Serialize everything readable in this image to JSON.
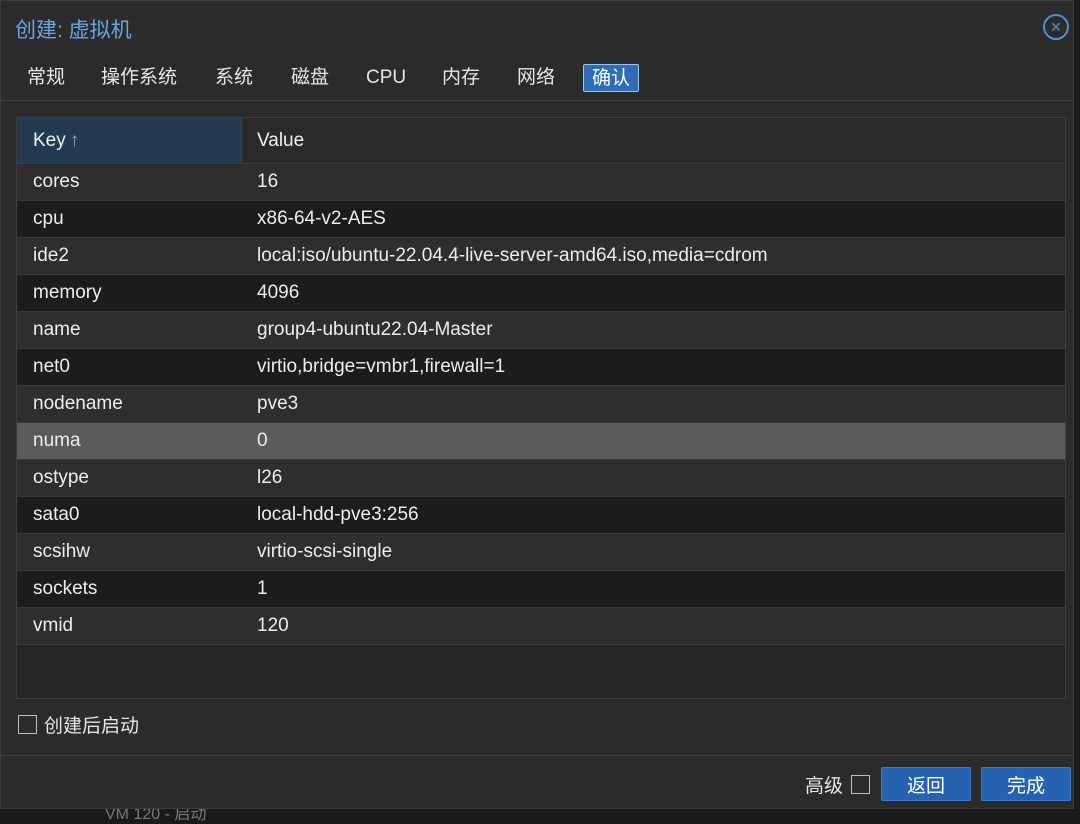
{
  "window": {
    "title": "创建: 虚拟机",
    "close_glyph": "✕"
  },
  "background": {
    "partial_text": "VM 120 - 启动"
  },
  "tabs": [
    {
      "label": "常规",
      "active": false
    },
    {
      "label": "操作系统",
      "active": false
    },
    {
      "label": "系统",
      "active": false
    },
    {
      "label": "磁盘",
      "active": false
    },
    {
      "label": "CPU",
      "active": false
    },
    {
      "label": "内存",
      "active": false
    },
    {
      "label": "网络",
      "active": false
    },
    {
      "label": "确认",
      "active": true
    }
  ],
  "grid": {
    "columns": {
      "key": "Key",
      "key_sort_glyph": "↑",
      "value": "Value"
    },
    "rows": [
      {
        "key": "cores",
        "value": "16"
      },
      {
        "key": "cpu",
        "value": "x86-64-v2-AES"
      },
      {
        "key": "ide2",
        "value": "local:iso/ubuntu-22.04.4-live-server-amd64.iso,media=cdrom"
      },
      {
        "key": "memory",
        "value": "4096"
      },
      {
        "key": "name",
        "value": "group4-ubuntu22.04-Master"
      },
      {
        "key": "net0",
        "value": "virtio,bridge=vmbr1,firewall=1"
      },
      {
        "key": "nodename",
        "value": "pve3"
      },
      {
        "key": "numa",
        "value": "0",
        "selected": true
      },
      {
        "key": "ostype",
        "value": "l26"
      },
      {
        "key": "sata0",
        "value": "local-hdd-pve3:256"
      },
      {
        "key": "scsihw",
        "value": "virtio-scsi-single"
      },
      {
        "key": "sockets",
        "value": "1"
      },
      {
        "key": "vmid",
        "value": "120"
      }
    ]
  },
  "options": {
    "start_after_created": {
      "label": "创建后启动",
      "checked": false
    }
  },
  "footer": {
    "advanced": {
      "label": "高级",
      "checked": false
    },
    "back_label": "返回",
    "finish_label": "完成"
  },
  "colors": {
    "accent": "#2563b0",
    "title": "#67a6e0",
    "selected_row": "#5b5b5b"
  }
}
